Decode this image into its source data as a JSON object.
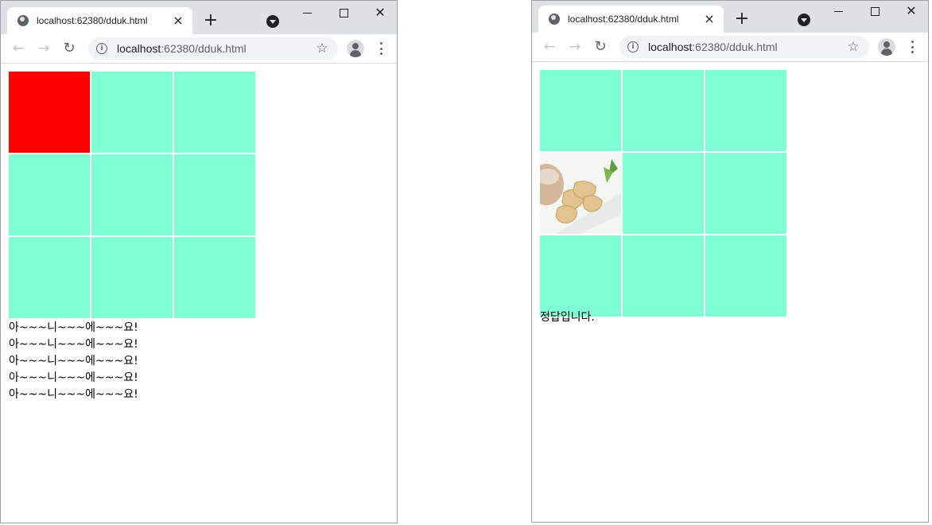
{
  "windows": [
    {
      "tab_title": "localhost:62380/dduk.html",
      "url_host": "localhost",
      "url_rest": ":62380/dduk.html",
      "grid": [
        "red",
        "aqua",
        "aqua",
        "aqua",
        "aqua",
        "aqua",
        "aqua",
        "aqua",
        "aqua"
      ],
      "messages": [
        "아~~~니~~~에~~~요!",
        "아~~~니~~~에~~~요!",
        "아~~~니~~~에~~~요!",
        "아~~~니~~~에~~~요!",
        "아~~~니~~~에~~~요!"
      ]
    },
    {
      "tab_title": "localhost:62380/dduk.html",
      "url_host": "localhost",
      "url_rest": ":62380/dduk.html",
      "grid": [
        "aqua",
        "aqua",
        "aqua",
        "photo",
        "aqua",
        "aqua",
        "aqua",
        "aqua",
        "aqua"
      ],
      "messages": [
        "정답입니다."
      ]
    }
  ],
  "icons": {
    "tab_close": "×",
    "new_tab": "+",
    "back": "←",
    "forward": "→",
    "reload": "↻",
    "star": "☆",
    "info": "i",
    "close": "✕"
  },
  "colors": {
    "cell": "#7fffd4",
    "selected": "#ff0000"
  }
}
